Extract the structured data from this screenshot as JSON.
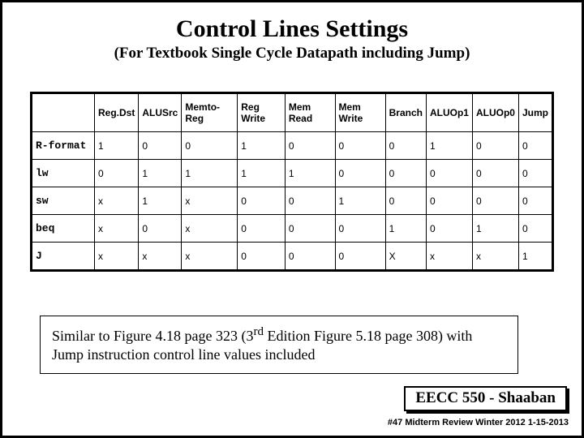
{
  "title": "Control Lines Settings",
  "subtitle": "(For Textbook Single Cycle Datapath including Jump)",
  "table": {
    "headers": [
      "",
      "Reg.Dst",
      "ALUSrc",
      "Memto-Reg",
      "Reg Write",
      "Mem Read",
      "Mem Write",
      "Branch",
      "ALUOp1",
      "ALUOp0",
      "Jump"
    ],
    "rows": [
      {
        "name": "R-format",
        "vals": [
          "1",
          "0",
          "0",
          "1",
          "0",
          "0",
          "0",
          "1",
          "0",
          "0"
        ]
      },
      {
        "name": "lw",
        "vals": [
          "0",
          "1",
          "1",
          "1",
          "1",
          "0",
          "0",
          "0",
          "0",
          "0"
        ]
      },
      {
        "name": "sw",
        "vals": [
          "x",
          "1",
          "x",
          "0",
          "0",
          "1",
          "0",
          "0",
          "0",
          "0"
        ]
      },
      {
        "name": "beq",
        "vals": [
          "x",
          "0",
          "x",
          "0",
          "0",
          "0",
          "1",
          "0",
          "1",
          "0"
        ]
      },
      {
        "name": "J",
        "vals": [
          "x",
          "x",
          "x",
          "0",
          "0",
          "0",
          "X",
          "x",
          "x",
          "1"
        ]
      }
    ]
  },
  "note": {
    "pre": "Similar to Figure 4.18 page 323 (3",
    "sup": "rd",
    "post": " Edition Figure 5.18 page 308) with Jump instruction control line values included"
  },
  "footer": {
    "course": "EECC 550 - Shaaban",
    "meta": "#47   Midterm Review  Winter 2012  1-15-2013"
  }
}
